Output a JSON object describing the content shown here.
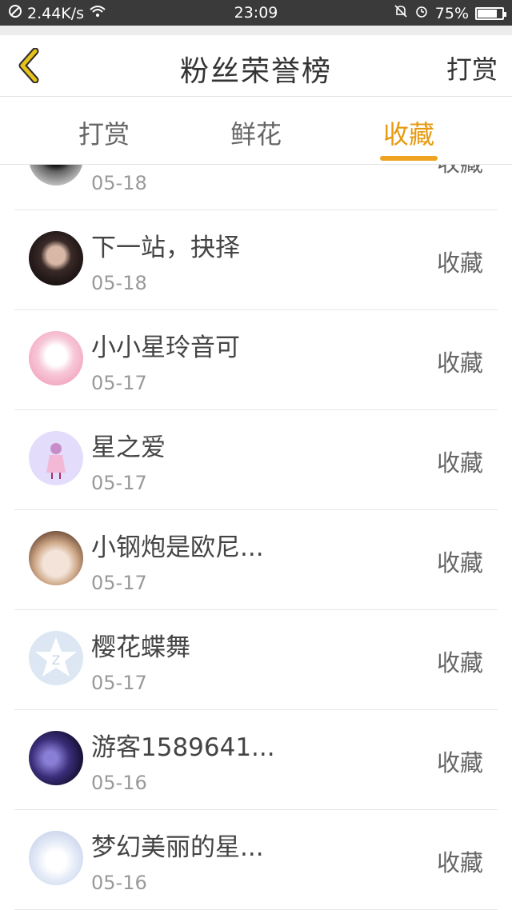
{
  "statusbar": {
    "speed": "2.44K/s",
    "time": "23:09",
    "battery": "75%"
  },
  "header": {
    "title": "粉丝荣誉榜",
    "right_action": "打赏"
  },
  "tabs": [
    {
      "label": "打赏",
      "active": false
    },
    {
      "label": "鲜花",
      "active": false
    },
    {
      "label": "收藏",
      "active": true
    }
  ],
  "list": [
    {
      "name": "",
      "date": "05-18",
      "action": "收藏",
      "avatar": "gray"
    },
    {
      "name": "下一站，抉择",
      "date": "05-18",
      "action": "收藏",
      "avatar": "girl-dark"
    },
    {
      "name": "小小星玲音可",
      "date": "05-17",
      "action": "收藏",
      "avatar": "pink"
    },
    {
      "name": "星之爱",
      "date": "05-17",
      "action": "收藏",
      "avatar": "lavender"
    },
    {
      "name": "小钢炮是欧尼...",
      "date": "05-17",
      "action": "收藏",
      "avatar": "doll"
    },
    {
      "name": "樱花蝶舞",
      "date": "05-17",
      "action": "收藏",
      "avatar": "qq-default"
    },
    {
      "name": "游客1589641...",
      "date": "05-16",
      "action": "收藏",
      "avatar": "purple-dark"
    },
    {
      "name": "梦幻美丽的星...",
      "date": "05-16",
      "action": "收藏",
      "avatar": "anime-light"
    }
  ]
}
